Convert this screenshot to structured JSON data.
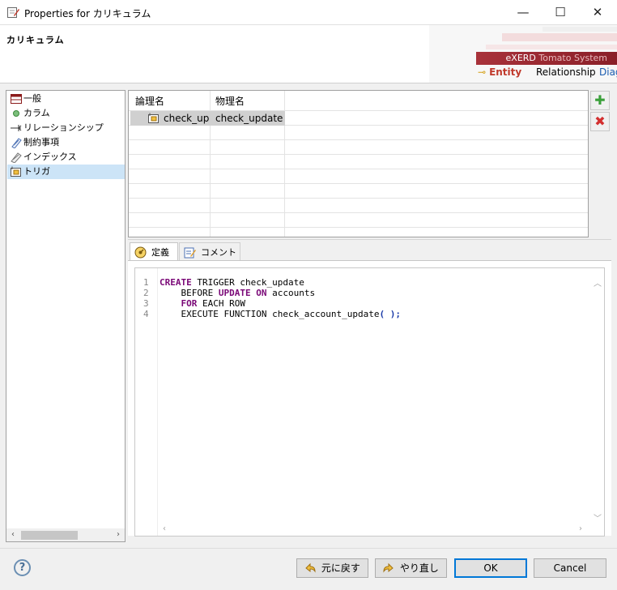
{
  "window": {
    "title": "Properties for カリキュラム",
    "minimize": "—",
    "maximize": "☐",
    "close": "✕"
  },
  "header": {
    "page_title": "カリキュラム",
    "brand": "eXERD",
    "brand_sub": "Tomato System",
    "tabs": {
      "entity": "Entity",
      "relationship": "Relationship",
      "diagram": "Diag"
    }
  },
  "tree": {
    "items": [
      {
        "label": "一般",
        "icon": "table-icon"
      },
      {
        "label": "カラム",
        "icon": "column-icon"
      },
      {
        "label": "リレーションシップ",
        "icon": "relationship-icon"
      },
      {
        "label": "制約事項",
        "icon": "constraint-icon"
      },
      {
        "label": "インデックス",
        "icon": "index-icon"
      },
      {
        "label": "トリガ",
        "icon": "trigger-icon",
        "selected": true
      }
    ]
  },
  "grid": {
    "columns": [
      "論理名",
      "物理名"
    ],
    "rows": [
      {
        "logical": "check_upd",
        "physical": "check_update"
      }
    ]
  },
  "tabs": {
    "definition": "定義",
    "comment": "コメント"
  },
  "editor": {
    "line_numbers": [
      "1",
      "2",
      "3",
      "4"
    ],
    "lines": [
      [
        {
          "t": "CREATE",
          "c": "kw"
        },
        {
          "t": " TRIGGER check_update",
          "c": ""
        }
      ],
      [
        {
          "t": "    BEFORE ",
          "c": ""
        },
        {
          "t": "UPDATE",
          "c": "kw"
        },
        {
          "t": " ",
          "c": ""
        },
        {
          "t": "ON",
          "c": "kw"
        },
        {
          "t": " accounts",
          "c": ""
        }
      ],
      [
        {
          "t": "    ",
          "c": ""
        },
        {
          "t": "FOR",
          "c": "kw"
        },
        {
          "t": " EACH ROW",
          "c": ""
        }
      ],
      [
        {
          "t": "    EXECUTE FUNCTION check_account_update",
          "c": ""
        },
        {
          "t": "( );",
          "c": "br"
        }
      ]
    ]
  },
  "footer": {
    "help": "?",
    "revert": "元に戻す",
    "redo": "やり直し",
    "ok": "OK",
    "cancel": "Cancel"
  }
}
